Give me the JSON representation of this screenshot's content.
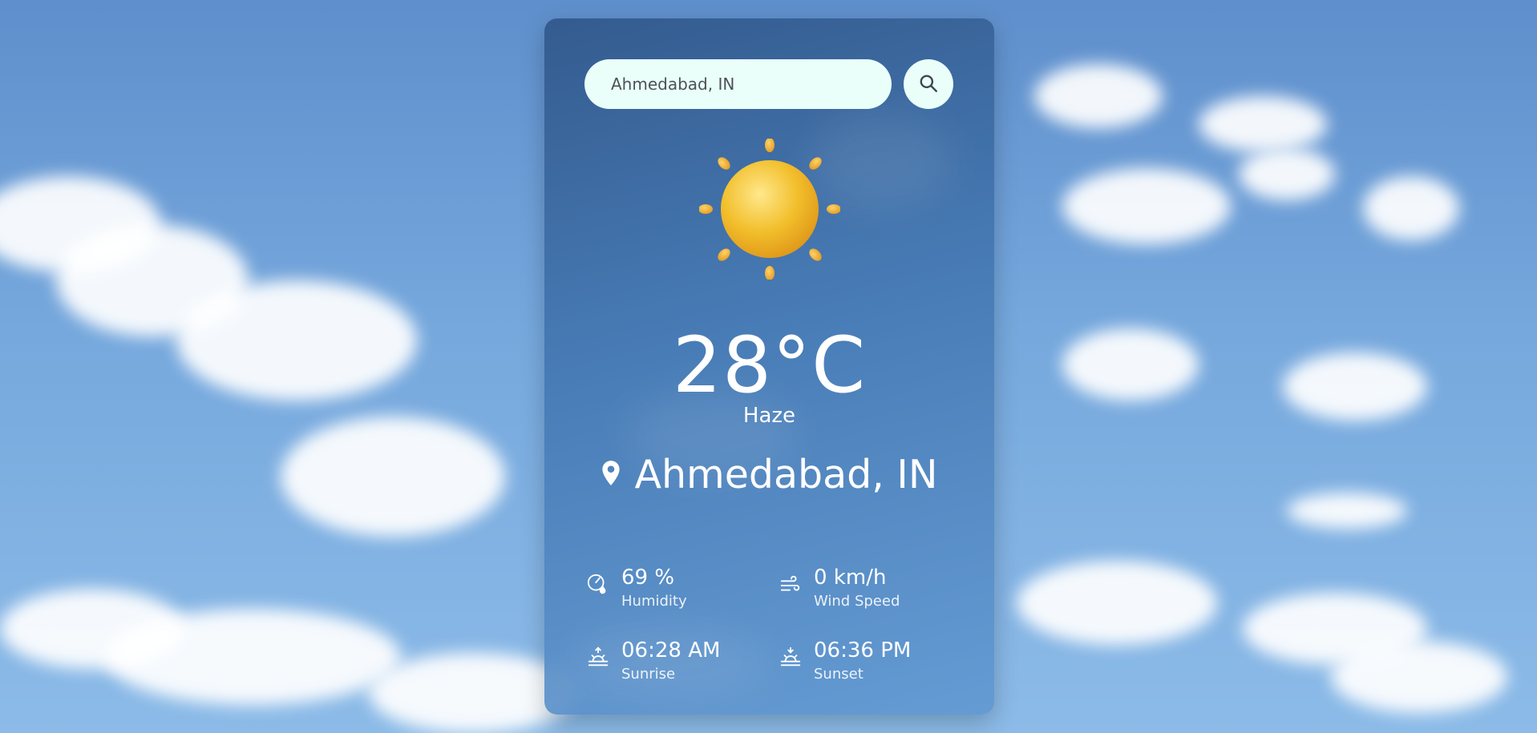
{
  "search": {
    "value": "Ahmedabad, IN",
    "button_icon": "search-icon"
  },
  "weather": {
    "icon": "sun-icon",
    "temperature": "28°C",
    "condition": "Haze",
    "location": "Ahmedabad, IN",
    "location_icon": "map-pin-icon"
  },
  "details": {
    "humidity": {
      "value": "69 %",
      "label": "Humidity",
      "icon": "humidity-icon"
    },
    "wind": {
      "value": "0 km/h",
      "label": "Wind Speed",
      "icon": "wind-icon"
    },
    "sunrise": {
      "value": "06:28 AM",
      "label": "Sunrise",
      "icon": "sunrise-icon"
    },
    "sunset": {
      "value": "06:36 PM",
      "label": "Sunset",
      "icon": "sunset-icon"
    }
  },
  "colors": {
    "card_top": "#30578A",
    "card_bottom": "#6299D2",
    "search_bg": "#EAFFF9",
    "text": "#FFFFFF"
  }
}
